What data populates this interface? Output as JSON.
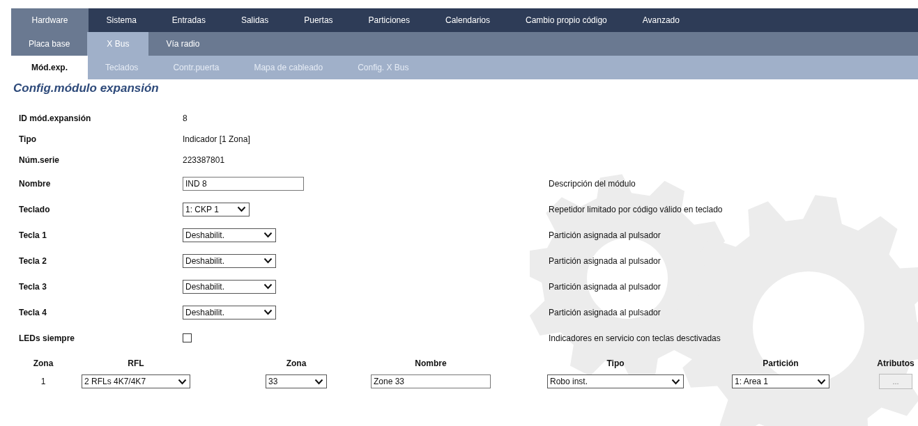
{
  "main_tabs": [
    {
      "label": "Hardware",
      "selected": true
    },
    {
      "label": "Sistema",
      "selected": false
    },
    {
      "label": "Entradas",
      "selected": false
    },
    {
      "label": "Salidas",
      "selected": false
    },
    {
      "label": "Puertas",
      "selected": false
    },
    {
      "label": "Particiones",
      "selected": false
    },
    {
      "label": "Calendarios",
      "selected": false
    },
    {
      "label": "Cambio propio código",
      "selected": false
    },
    {
      "label": "Avanzado",
      "selected": false
    }
  ],
  "sub_tabs": [
    {
      "label": "Placa base",
      "selected": false
    },
    {
      "label": "X Bus",
      "selected": true
    },
    {
      "label": "Vía radio",
      "selected": false
    }
  ],
  "section_tabs": [
    {
      "label": "Mód.exp.",
      "selected": true
    },
    {
      "label": "Teclados",
      "selected": false
    },
    {
      "label": "Contr.puerta",
      "selected": false
    },
    {
      "label": "Mapa de cableado",
      "selected": false
    },
    {
      "label": "Config. X Bus",
      "selected": false
    }
  ],
  "title": "Config.módulo expansión",
  "fields": [
    {
      "kind": "text",
      "label": "ID mód.expansión",
      "value": "8"
    },
    {
      "kind": "text",
      "label": "Tipo",
      "value": "Indicador [1 Zona]"
    },
    {
      "kind": "text",
      "label": "Núm.serie",
      "value": "223387801"
    },
    {
      "kind": "input",
      "label": "Nombre",
      "value": "IND 8",
      "description": "Descripción del módulo"
    },
    {
      "kind": "select",
      "label": "Teclado",
      "value": "1: CKP 1",
      "description": "Repetidor limitado por código válido en teclado"
    },
    {
      "kind": "select",
      "label": "Tecla 1",
      "value": "Deshabilit.",
      "description": "Partición asignada al pulsador"
    },
    {
      "kind": "select",
      "label": "Tecla 2",
      "value": "Deshabilit.",
      "description": "Partición asignada al pulsador"
    },
    {
      "kind": "select",
      "label": "Tecla 3",
      "value": "Deshabilit.",
      "description": "Partición asignada al pulsador"
    },
    {
      "kind": "select",
      "label": "Tecla 4",
      "value": "Deshabilit.",
      "description": "Partición asignada al pulsador"
    },
    {
      "kind": "checkbox",
      "label": "LEDs siempre",
      "checked": false,
      "description": "Indicadores en servicio con teclas desctivadas"
    }
  ],
  "zone_table": {
    "columns": [
      "Zona",
      "RFL",
      "Zona",
      "Nombre",
      "Tipo",
      "Partición",
      "Atributos"
    ],
    "rows": [
      {
        "zona": "1",
        "rfl": "2 RFLs 4K7/4K7",
        "zona_select": "33",
        "nombre": "Zone 33",
        "tipo": "Robo inst.",
        "particion": "1: Area 1",
        "atributos": "..."
      }
    ]
  }
}
